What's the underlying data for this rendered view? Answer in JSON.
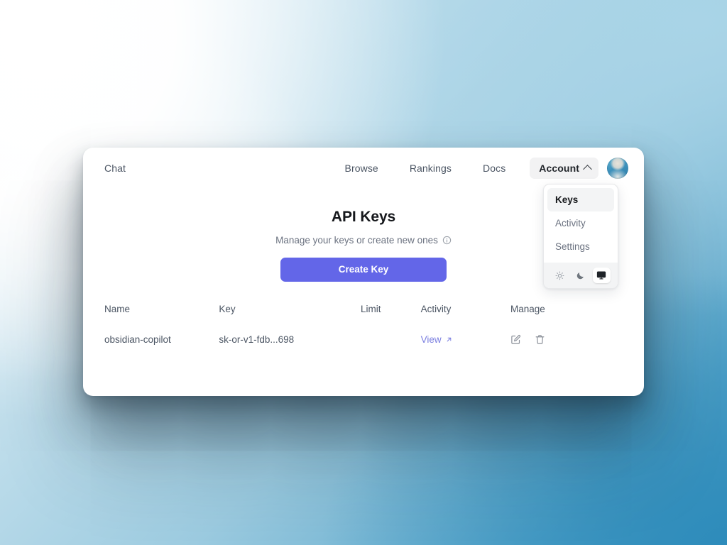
{
  "nav": {
    "left": [
      {
        "label": "Chat",
        "name": "nav-chat"
      }
    ],
    "right": [
      {
        "label": "Browse",
        "name": "nav-browse"
      },
      {
        "label": "Rankings",
        "name": "nav-rankings"
      },
      {
        "label": "Docs",
        "name": "nav-docs"
      }
    ],
    "account_label": "Account",
    "chevron_icon": "chevron-up-icon",
    "avatar_icon": "user-avatar"
  },
  "dropdown": {
    "items": [
      {
        "label": "Keys",
        "active": true
      },
      {
        "label": "Activity",
        "active": false
      },
      {
        "label": "Settings",
        "active": false
      }
    ],
    "theme_options": [
      {
        "icon": "sun-icon",
        "selected": false
      },
      {
        "icon": "moon-icon",
        "selected": false
      },
      {
        "icon": "monitor-icon",
        "selected": true
      }
    ]
  },
  "main": {
    "title": "API Keys",
    "subtitle": "Manage your keys or create new ones",
    "info_icon": "info-icon",
    "create_button": "Create Key"
  },
  "table": {
    "columns": [
      "Name",
      "Key",
      "Limit",
      "Activity",
      "Manage"
    ],
    "rows": [
      {
        "name": "obsidian-copilot",
        "key": "sk-or-v1-fdb...698",
        "limit": "",
        "activity": "View",
        "activity_icon": "external-link-icon",
        "manage": [
          "edit-icon",
          "trash-icon"
        ]
      }
    ]
  },
  "colors": {
    "accent": "#6366e8",
    "link": "#7b7fe0",
    "card_bg": "#ffffff",
    "menu_active_bg": "#f3f4f5",
    "backdrop_dark": "#3f93bd",
    "backdrop_light": "#ffffff"
  }
}
